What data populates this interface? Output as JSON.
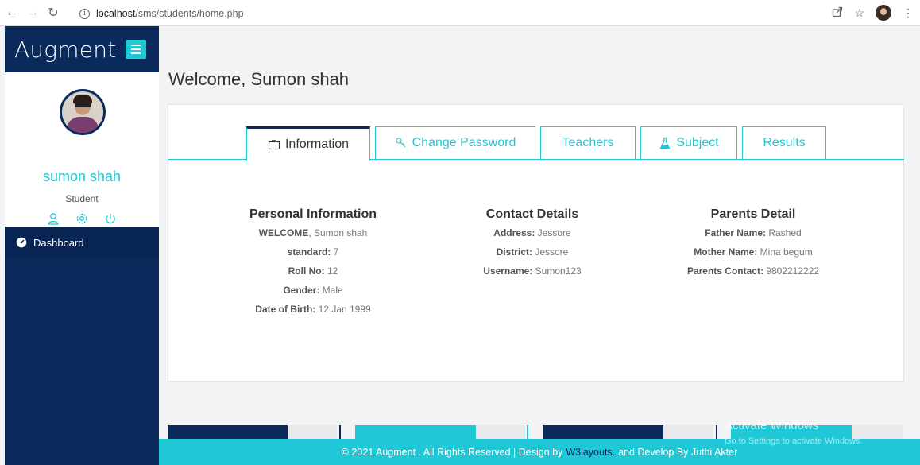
{
  "browser": {
    "url_host": "localhost",
    "url_path": "/sms/students/home.php"
  },
  "sidebar": {
    "brand": "Augment",
    "profile": {
      "name": "sumon shah",
      "role": "Student"
    },
    "menu": [
      {
        "label": "Dashboard",
        "icon": "dashboard-icon"
      }
    ]
  },
  "main": {
    "welcome": "Welcome, Sumon shah",
    "tabs": [
      {
        "label": "Information",
        "icon": "briefcase-icon",
        "active": true
      },
      {
        "label": "Change Password",
        "icon": "key-icon",
        "active": false
      },
      {
        "label": "Teachers",
        "icon": "",
        "active": false
      },
      {
        "label": "Subject",
        "icon": "flask-icon",
        "active": false
      },
      {
        "label": "Results",
        "icon": "",
        "active": false
      }
    ],
    "personal": {
      "title": "Personal Information",
      "rows": [
        {
          "label": "WELCOME",
          "sep": ", ",
          "value": "Sumon shah"
        },
        {
          "label": "standard:",
          "sep": " ",
          "value": "7"
        },
        {
          "label": "Roll No:",
          "sep": " ",
          "value": "12"
        },
        {
          "label": "Gender:",
          "sep": " ",
          "value": "Male"
        },
        {
          "label": "Date of Birth:",
          "sep": " ",
          "value": "12 Jan 1999"
        }
      ]
    },
    "contact": {
      "title": "Contact Details",
      "rows": [
        {
          "label": "Address:",
          "sep": " ",
          "value": "Jessore"
        },
        {
          "label": "District:",
          "sep": " ",
          "value": "Jessore"
        },
        {
          "label": "Username:",
          "sep": " ",
          "value": "Sumon123"
        }
      ]
    },
    "parents": {
      "title": "Parents Detail",
      "rows": [
        {
          "label": "Father Name:",
          "sep": " ",
          "value": "Rashed"
        },
        {
          "label": "Mother Name:",
          "sep": " ",
          "value": "Mina begum"
        },
        {
          "label": "Parents Contact:",
          "sep": " ",
          "value": "9802212222"
        }
      ]
    }
  },
  "footer": {
    "text_before": "© 2021 Augment . All Rights Reserved | Design by",
    "link": "W3layouts.",
    "text_after": "and Develop By Juthi Akter"
  },
  "watermark": {
    "title": "Activate Windows",
    "subtitle": "Go to Settings to activate Windows."
  },
  "colors": {
    "navy": "#0a2a5c",
    "cyan": "#1ec8d6"
  }
}
